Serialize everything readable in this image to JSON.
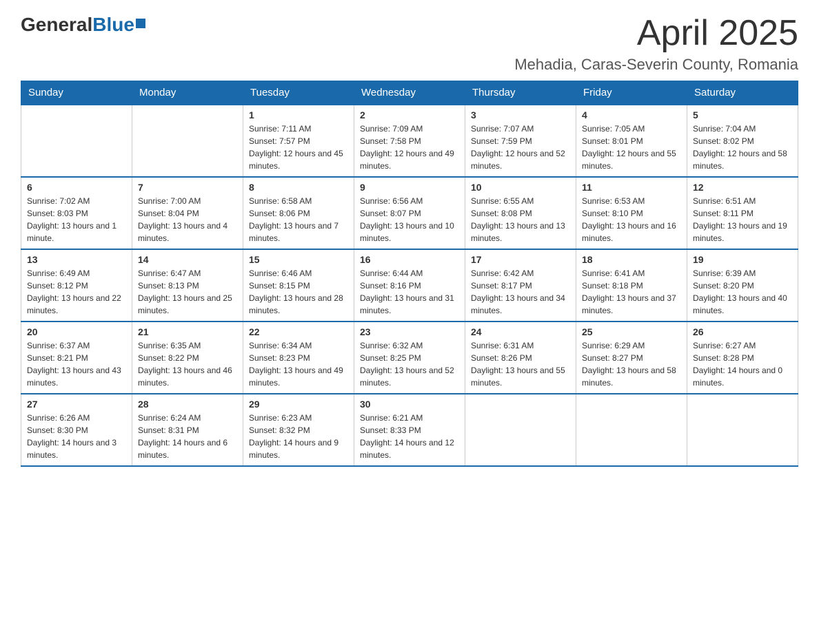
{
  "logo": {
    "general": "General",
    "blue": "Blue"
  },
  "header": {
    "month": "April 2025",
    "location": "Mehadia, Caras-Severin County, Romania"
  },
  "weekdays": [
    "Sunday",
    "Monday",
    "Tuesday",
    "Wednesday",
    "Thursday",
    "Friday",
    "Saturday"
  ],
  "weeks": [
    [
      {
        "day": "",
        "sunrise": "",
        "sunset": "",
        "daylight": ""
      },
      {
        "day": "",
        "sunrise": "",
        "sunset": "",
        "daylight": ""
      },
      {
        "day": "1",
        "sunrise": "Sunrise: 7:11 AM",
        "sunset": "Sunset: 7:57 PM",
        "daylight": "Daylight: 12 hours and 45 minutes."
      },
      {
        "day": "2",
        "sunrise": "Sunrise: 7:09 AM",
        "sunset": "Sunset: 7:58 PM",
        "daylight": "Daylight: 12 hours and 49 minutes."
      },
      {
        "day": "3",
        "sunrise": "Sunrise: 7:07 AM",
        "sunset": "Sunset: 7:59 PM",
        "daylight": "Daylight: 12 hours and 52 minutes."
      },
      {
        "day": "4",
        "sunrise": "Sunrise: 7:05 AM",
        "sunset": "Sunset: 8:01 PM",
        "daylight": "Daylight: 12 hours and 55 minutes."
      },
      {
        "day": "5",
        "sunrise": "Sunrise: 7:04 AM",
        "sunset": "Sunset: 8:02 PM",
        "daylight": "Daylight: 12 hours and 58 minutes."
      }
    ],
    [
      {
        "day": "6",
        "sunrise": "Sunrise: 7:02 AM",
        "sunset": "Sunset: 8:03 PM",
        "daylight": "Daylight: 13 hours and 1 minute."
      },
      {
        "day": "7",
        "sunrise": "Sunrise: 7:00 AM",
        "sunset": "Sunset: 8:04 PM",
        "daylight": "Daylight: 13 hours and 4 minutes."
      },
      {
        "day": "8",
        "sunrise": "Sunrise: 6:58 AM",
        "sunset": "Sunset: 8:06 PM",
        "daylight": "Daylight: 13 hours and 7 minutes."
      },
      {
        "day": "9",
        "sunrise": "Sunrise: 6:56 AM",
        "sunset": "Sunset: 8:07 PM",
        "daylight": "Daylight: 13 hours and 10 minutes."
      },
      {
        "day": "10",
        "sunrise": "Sunrise: 6:55 AM",
        "sunset": "Sunset: 8:08 PM",
        "daylight": "Daylight: 13 hours and 13 minutes."
      },
      {
        "day": "11",
        "sunrise": "Sunrise: 6:53 AM",
        "sunset": "Sunset: 8:10 PM",
        "daylight": "Daylight: 13 hours and 16 minutes."
      },
      {
        "day": "12",
        "sunrise": "Sunrise: 6:51 AM",
        "sunset": "Sunset: 8:11 PM",
        "daylight": "Daylight: 13 hours and 19 minutes."
      }
    ],
    [
      {
        "day": "13",
        "sunrise": "Sunrise: 6:49 AM",
        "sunset": "Sunset: 8:12 PM",
        "daylight": "Daylight: 13 hours and 22 minutes."
      },
      {
        "day": "14",
        "sunrise": "Sunrise: 6:47 AM",
        "sunset": "Sunset: 8:13 PM",
        "daylight": "Daylight: 13 hours and 25 minutes."
      },
      {
        "day": "15",
        "sunrise": "Sunrise: 6:46 AM",
        "sunset": "Sunset: 8:15 PM",
        "daylight": "Daylight: 13 hours and 28 minutes."
      },
      {
        "day": "16",
        "sunrise": "Sunrise: 6:44 AM",
        "sunset": "Sunset: 8:16 PM",
        "daylight": "Daylight: 13 hours and 31 minutes."
      },
      {
        "day": "17",
        "sunrise": "Sunrise: 6:42 AM",
        "sunset": "Sunset: 8:17 PM",
        "daylight": "Daylight: 13 hours and 34 minutes."
      },
      {
        "day": "18",
        "sunrise": "Sunrise: 6:41 AM",
        "sunset": "Sunset: 8:18 PM",
        "daylight": "Daylight: 13 hours and 37 minutes."
      },
      {
        "day": "19",
        "sunrise": "Sunrise: 6:39 AM",
        "sunset": "Sunset: 8:20 PM",
        "daylight": "Daylight: 13 hours and 40 minutes."
      }
    ],
    [
      {
        "day": "20",
        "sunrise": "Sunrise: 6:37 AM",
        "sunset": "Sunset: 8:21 PM",
        "daylight": "Daylight: 13 hours and 43 minutes."
      },
      {
        "day": "21",
        "sunrise": "Sunrise: 6:35 AM",
        "sunset": "Sunset: 8:22 PM",
        "daylight": "Daylight: 13 hours and 46 minutes."
      },
      {
        "day": "22",
        "sunrise": "Sunrise: 6:34 AM",
        "sunset": "Sunset: 8:23 PM",
        "daylight": "Daylight: 13 hours and 49 minutes."
      },
      {
        "day": "23",
        "sunrise": "Sunrise: 6:32 AM",
        "sunset": "Sunset: 8:25 PM",
        "daylight": "Daylight: 13 hours and 52 minutes."
      },
      {
        "day": "24",
        "sunrise": "Sunrise: 6:31 AM",
        "sunset": "Sunset: 8:26 PM",
        "daylight": "Daylight: 13 hours and 55 minutes."
      },
      {
        "day": "25",
        "sunrise": "Sunrise: 6:29 AM",
        "sunset": "Sunset: 8:27 PM",
        "daylight": "Daylight: 13 hours and 58 minutes."
      },
      {
        "day": "26",
        "sunrise": "Sunrise: 6:27 AM",
        "sunset": "Sunset: 8:28 PM",
        "daylight": "Daylight: 14 hours and 0 minutes."
      }
    ],
    [
      {
        "day": "27",
        "sunrise": "Sunrise: 6:26 AM",
        "sunset": "Sunset: 8:30 PM",
        "daylight": "Daylight: 14 hours and 3 minutes."
      },
      {
        "day": "28",
        "sunrise": "Sunrise: 6:24 AM",
        "sunset": "Sunset: 8:31 PM",
        "daylight": "Daylight: 14 hours and 6 minutes."
      },
      {
        "day": "29",
        "sunrise": "Sunrise: 6:23 AM",
        "sunset": "Sunset: 8:32 PM",
        "daylight": "Daylight: 14 hours and 9 minutes."
      },
      {
        "day": "30",
        "sunrise": "Sunrise: 6:21 AM",
        "sunset": "Sunset: 8:33 PM",
        "daylight": "Daylight: 14 hours and 12 minutes."
      },
      {
        "day": "",
        "sunrise": "",
        "sunset": "",
        "daylight": ""
      },
      {
        "day": "",
        "sunrise": "",
        "sunset": "",
        "daylight": ""
      },
      {
        "day": "",
        "sunrise": "",
        "sunset": "",
        "daylight": ""
      }
    ]
  ]
}
